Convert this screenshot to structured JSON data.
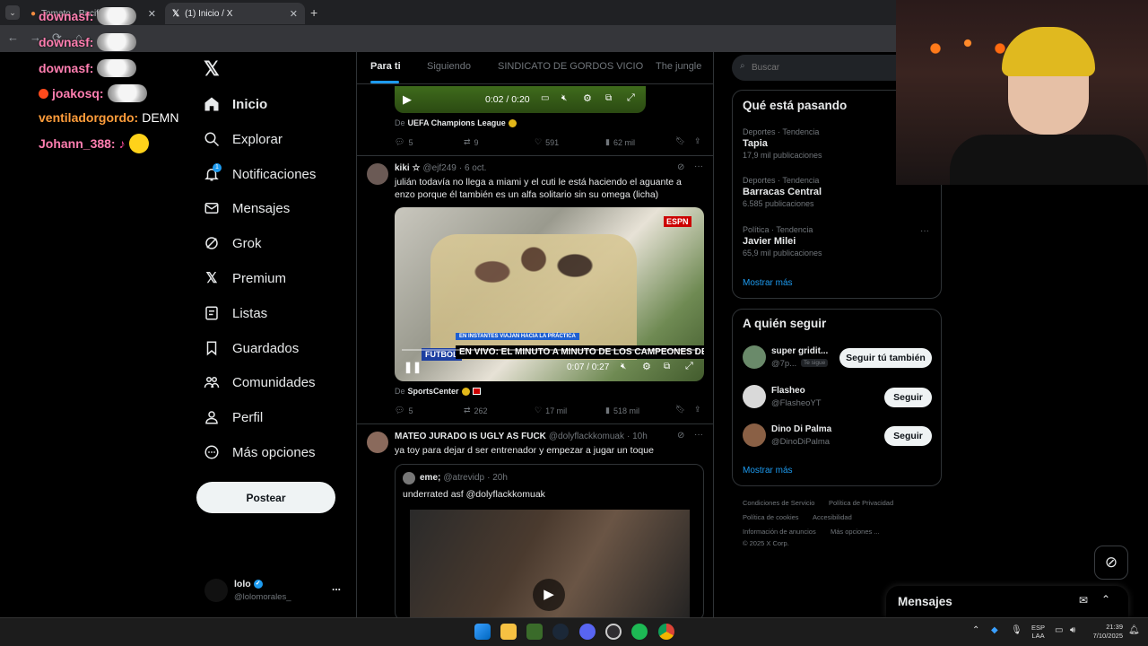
{
  "browser": {
    "tabs": [
      {
        "title": "Tomato - Pacifico"
      },
      {
        "title": "(1) Inicio / X"
      }
    ],
    "new_tab": "+"
  },
  "chat": [
    {
      "user": "downasf:",
      "color": "#ff7eb0",
      "msg": ""
    },
    {
      "user": "downasf:",
      "color": "#ff7eb0",
      "msg": ""
    },
    {
      "user": "downasf:",
      "color": "#ff7eb0",
      "msg": ""
    },
    {
      "user": "joakosq:",
      "color": "#ff7eb0",
      "msg": ""
    },
    {
      "user": "ventiladorgordo:",
      "color": "#ff9d3b",
      "msg": " DEMN"
    },
    {
      "user": "Johann_388:",
      "color": "#ff7eb0",
      "msg": ""
    }
  ],
  "nav": {
    "items": [
      "Inicio",
      "Explorar",
      "Notificaciones",
      "Mensajes",
      "Grok",
      "Premium",
      "Listas",
      "Guardados",
      "Comunidades",
      "Perfil",
      "Más opciones"
    ],
    "notif_badge": "1",
    "post_label": "Postear",
    "account": {
      "name": "lolo",
      "handle": "@lolomorales_",
      "more": "..."
    }
  },
  "feed": {
    "tabs": [
      "Para ti",
      "Siguiendo",
      "SINDICATO DE GORDOS VICIO",
      "The jungle"
    ],
    "video1": {
      "time": "0:02 / 0:20",
      "source_prefix": "De",
      "source": "UEFA Champions League"
    },
    "stats1": {
      "replies": "5",
      "retweets": "9",
      "likes": "591",
      "views": "62 mil"
    },
    "tweet2": {
      "name": "kiki ☆",
      "handle": "@ejf249",
      "date": "· 6 oct.",
      "text": "julián todavía no llega a miami y el cuti le está haciendo el aguante a enzo porque él también es un alfa solitario sin su omega (licha)",
      "video_banner": "EN INSTANTES VIAJAN HACIA LA PRÁCTICA",
      "video_title": "EN VIVO: EL MINUTO A MINUTO DE LOS CAMPEONES DEL MUNDO",
      "video_tag": "FUTBOL",
      "video_time": "0:07 / 0:27",
      "video_brand": "ESPN",
      "source_prefix": "De",
      "source": "SportsCenter",
      "stats": {
        "replies": "5",
        "retweets": "262",
        "likes": "17 mil",
        "views": "518 mil"
      }
    },
    "tweet3": {
      "name": "MATEO JURADO IS UGLY AS FUCK",
      "handle": "@dolyflackkomuak",
      "date": "· 10h",
      "text": "ya toy para dejar d ser entrenador y empezar a jugar un toque",
      "quote": {
        "name": "eme;",
        "handle": "@atrevidp",
        "date": "· 20h",
        "text": "underrated asf @dolyflackkomuak"
      }
    }
  },
  "right": {
    "search_placeholder": "Buscar",
    "trends_title": "Qué está pasando",
    "trends": [
      {
        "category": "Deportes · Tendencia",
        "name": "Tapia",
        "count": "17,9 mil publicaciones"
      },
      {
        "category": "Deportes · Tendencia",
        "name": "Barracas Central",
        "count": "6.585 publicaciones"
      },
      {
        "category": "Política · Tendencia",
        "name": "Javier Milei",
        "count": "65,9 mil publicaciones"
      }
    ],
    "trends_more": "Mostrar más",
    "follow_title": "A quién seguir",
    "follow": [
      {
        "name": "super gridit...",
        "handle": "@7p...",
        "badge": "Te sigue",
        "button": "Seguir tú también"
      },
      {
        "name": "Flasheo",
        "handle": "@FlasheoYT",
        "button": "Seguir"
      },
      {
        "name": "Dino Di Palma",
        "handle": "@DinoDiPalma",
        "button": "Seguir"
      }
    ],
    "follow_more": "Mostrar más",
    "footer": [
      "Condiciones de Servicio",
      "Política de Privacidad",
      "Política de cookies",
      "Accesibilidad",
      "Información de anuncios",
      "Más opciones ...",
      "© 2025 X Corp."
    ],
    "messages_label": "Mensajes"
  },
  "taskbar": {
    "lang": "ESP",
    "lang2": "LAA",
    "time": "21:39",
    "date": "7/10/2025"
  },
  "colors": {
    "accent": "#1d9bf0",
    "background": "#000000",
    "border": "#2f3336"
  }
}
